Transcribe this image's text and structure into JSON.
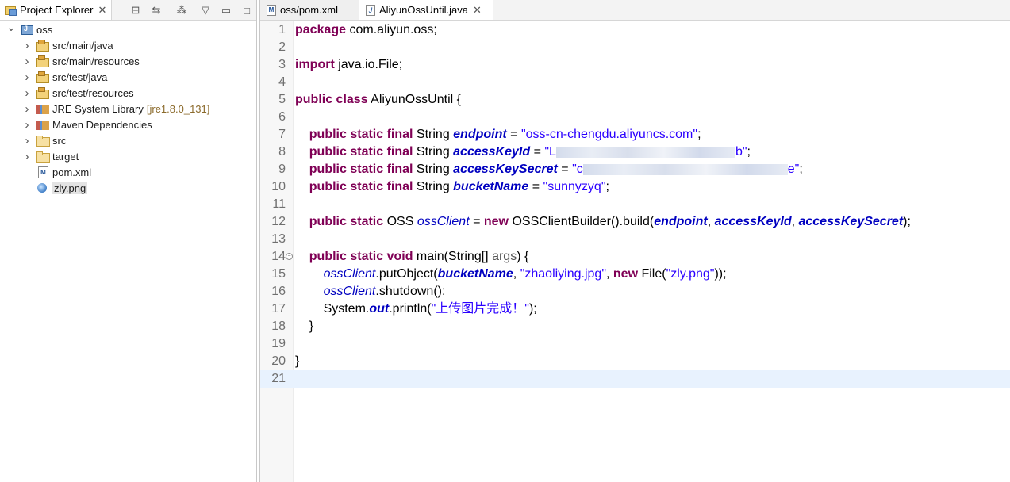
{
  "explorer": {
    "tab_label": "Project Explorer",
    "toolbar_icons": [
      "collapse-all-icon",
      "link-with-editor-icon",
      "filters-icon",
      "view-menu-icon",
      "minimize-icon",
      "maximize-icon"
    ],
    "tree": [
      {
        "label": "oss",
        "decoration": "",
        "icon": "project-icon",
        "expanded": true,
        "depth": 0
      },
      {
        "label": "src/main/java",
        "decoration": "",
        "icon": "source-folder-icon",
        "depth": 1
      },
      {
        "label": "src/main/resources",
        "decoration": "",
        "icon": "source-folder-icon",
        "depth": 1
      },
      {
        "label": "src/test/java",
        "decoration": "",
        "icon": "source-folder-icon",
        "depth": 1
      },
      {
        "label": "src/test/resources",
        "decoration": "",
        "icon": "source-folder-icon",
        "depth": 1
      },
      {
        "label": "JRE System Library",
        "decoration": "[jre1.8.0_131]",
        "icon": "library-icon",
        "depth": 1
      },
      {
        "label": "Maven Dependencies",
        "decoration": "",
        "icon": "library-icon",
        "depth": 1
      },
      {
        "label": "src",
        "decoration": "",
        "icon": "folder-icon",
        "depth": 1
      },
      {
        "label": "target",
        "decoration": "",
        "icon": "folder-icon",
        "depth": 1
      },
      {
        "label": "pom.xml",
        "decoration": "",
        "icon": "xml-file-icon",
        "depth": 1
      },
      {
        "label": "zly.png",
        "decoration": "",
        "icon": "image-file-icon",
        "depth": 1,
        "selected": true
      }
    ]
  },
  "editor": {
    "tabs": [
      {
        "label": "oss/pom.xml",
        "active": false
      },
      {
        "label": "AliyunOssUntil.java",
        "active": true
      }
    ],
    "lines": [
      {
        "n": "1",
        "tokens": [
          [
            "kw",
            "package"
          ],
          [
            "plain",
            " com.aliyun.oss;"
          ]
        ]
      },
      {
        "n": "2",
        "tokens": []
      },
      {
        "n": "3",
        "tokens": [
          [
            "kw",
            "import"
          ],
          [
            "plain",
            " java.io.File;"
          ]
        ]
      },
      {
        "n": "4",
        "tokens": []
      },
      {
        "n": "5",
        "tokens": [
          [
            "kw",
            "public class"
          ],
          [
            "plain",
            " AliyunOssUntil {"
          ]
        ]
      },
      {
        "n": "6",
        "tokens": []
      },
      {
        "n": "7",
        "tokens": [
          [
            "plain",
            "    "
          ],
          [
            "kw",
            "public static final"
          ],
          [
            "plain",
            " String "
          ],
          [
            "fld",
            "endpoint"
          ],
          [
            "plain",
            " = "
          ],
          [
            "str",
            "\"oss-cn-chengdu.aliyuncs.com\""
          ],
          [
            "plain",
            ";"
          ]
        ]
      },
      {
        "n": "8",
        "tokens": [
          [
            "plain",
            "    "
          ],
          [
            "kw",
            "public static final"
          ],
          [
            "plain",
            " String "
          ],
          [
            "fld",
            "accessKeyId"
          ],
          [
            "plain",
            " = "
          ],
          [
            "str",
            "\"L"
          ],
          [
            "blur",
            "226"
          ],
          [
            "str",
            "b\""
          ],
          [
            "plain",
            ";"
          ]
        ]
      },
      {
        "n": "9",
        "tokens": [
          [
            "plain",
            "    "
          ],
          [
            "kw",
            "public static final"
          ],
          [
            "plain",
            " String "
          ],
          [
            "fld",
            "accessKeySecret"
          ],
          [
            "plain",
            " = "
          ],
          [
            "str",
            "\"c"
          ],
          [
            "blur",
            "258"
          ],
          [
            "str",
            "e\""
          ],
          [
            "plain",
            ";"
          ]
        ]
      },
      {
        "n": "10",
        "tokens": [
          [
            "plain",
            "    "
          ],
          [
            "kw",
            "public static final"
          ],
          [
            "plain",
            " String "
          ],
          [
            "fld",
            "bucketName"
          ],
          [
            "plain",
            " = "
          ],
          [
            "str",
            "\"sunnyzyq\""
          ],
          [
            "plain",
            ";"
          ]
        ]
      },
      {
        "n": "11",
        "tokens": []
      },
      {
        "n": "12",
        "tokens": [
          [
            "plain",
            "    "
          ],
          [
            "kw",
            "public static"
          ],
          [
            "plain",
            " OSS "
          ],
          [
            "fldi",
            "ossClient"
          ],
          [
            "plain",
            " = "
          ],
          [
            "kw",
            "new"
          ],
          [
            "plain",
            " OSSClientBuilder().build("
          ],
          [
            "fld",
            "endpoint"
          ],
          [
            "plain",
            ", "
          ],
          [
            "fld",
            "accessKeyId"
          ],
          [
            "plain",
            ", "
          ],
          [
            "fld",
            "accessKeySecret"
          ],
          [
            "plain",
            ");"
          ]
        ]
      },
      {
        "n": "13",
        "tokens": []
      },
      {
        "n": "14",
        "fold": true,
        "tokens": [
          [
            "plain",
            "    "
          ],
          [
            "kw",
            "public static void"
          ],
          [
            "plain",
            " main(String[] "
          ],
          [
            "par",
            "args"
          ],
          [
            "plain",
            ") {"
          ]
        ]
      },
      {
        "n": "15",
        "tokens": [
          [
            "plain",
            "        "
          ],
          [
            "fldi",
            "ossClient"
          ],
          [
            "plain",
            ".putObject("
          ],
          [
            "fld",
            "bucketName"
          ],
          [
            "plain",
            ", "
          ],
          [
            "str",
            "\"zhaoliying.jpg\""
          ],
          [
            "plain",
            ", "
          ],
          [
            "kw",
            "new"
          ],
          [
            "plain",
            " File("
          ],
          [
            "str",
            "\"zly.png\""
          ],
          [
            "plain",
            "));"
          ]
        ]
      },
      {
        "n": "16",
        "tokens": [
          [
            "plain",
            "        "
          ],
          [
            "fldi",
            "ossClient"
          ],
          [
            "plain",
            ".shutdown();"
          ]
        ]
      },
      {
        "n": "17",
        "tokens": [
          [
            "plain",
            "        System."
          ],
          [
            "fld",
            "out"
          ],
          [
            "plain",
            ".println("
          ],
          [
            "str",
            "\"上传图片完成！\""
          ],
          [
            "plain",
            ");"
          ]
        ]
      },
      {
        "n": "18",
        "tokens": [
          [
            "plain",
            "    }"
          ]
        ]
      },
      {
        "n": "19",
        "tokens": []
      },
      {
        "n": "20",
        "tokens": [
          [
            "plain",
            "}"
          ]
        ]
      },
      {
        "n": "21",
        "tokens": [],
        "current": true
      }
    ]
  }
}
